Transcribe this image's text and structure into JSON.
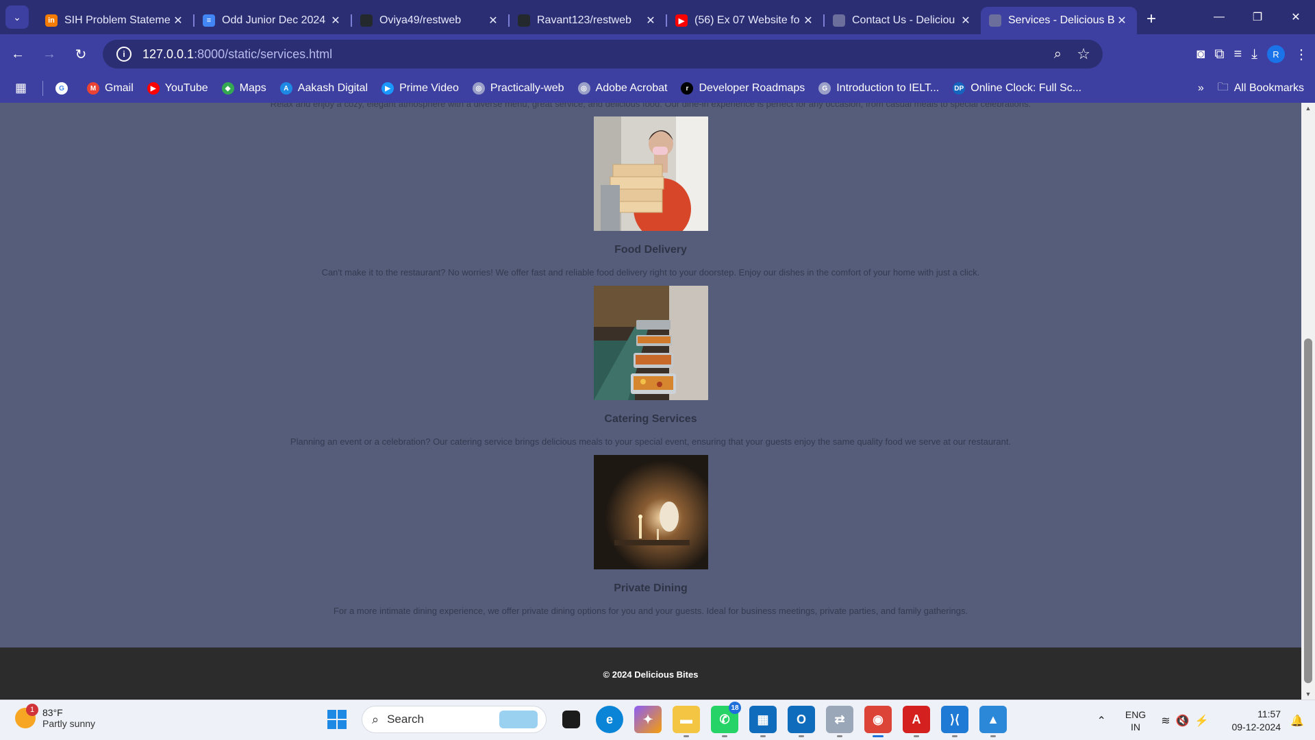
{
  "browser": {
    "tabs": [
      {
        "title": "SIH Problem Stateme",
        "favicon_color": "#f57c00",
        "favicon_text": "in"
      },
      {
        "title": "Odd Junior Dec 2024",
        "favicon_color": "#4285f4",
        "favicon_text": "≡"
      },
      {
        "title": "Oviya49/restweb",
        "favicon_color": "#24292e",
        "favicon_text": ""
      },
      {
        "title": "Ravant123/restweb",
        "favicon_color": "#24292e",
        "favicon_text": ""
      },
      {
        "title": "(56) Ex 07 Website fo",
        "favicon_color": "#ff0000",
        "favicon_text": "▶"
      },
      {
        "title": "Contact Us - Deliciou",
        "favicon_color": "#6c6f9c",
        "favicon_text": ""
      },
      {
        "title": "Services - Delicious B",
        "favicon_color": "#6c6f9c",
        "favicon_text": "",
        "active": true
      }
    ],
    "url": {
      "host": "127.0.0.1",
      "path": ":8000/static/services.html"
    },
    "bookmarks": [
      {
        "label": "",
        "color": "#ffffff",
        "text": "G"
      },
      {
        "label": "Gmail",
        "color": "#ea4335",
        "text": "M"
      },
      {
        "label": "YouTube",
        "color": "#ff0000",
        "text": "▶"
      },
      {
        "label": "Maps",
        "color": "#34a853",
        "text": "◆"
      },
      {
        "label": "Aakash Digital",
        "color": "#1e88e5",
        "text": "A"
      },
      {
        "label": "Prime Video",
        "color": "#1a98ff",
        "text": "▶"
      },
      {
        "label": "Practically-web",
        "color": "#9aa0c8",
        "text": "◎"
      },
      {
        "label": "Adobe Acrobat",
        "color": "#9aa0c8",
        "text": "◎"
      },
      {
        "label": "Developer Roadmaps",
        "color": "#000000",
        "text": "r"
      },
      {
        "label": "Introduction to IELT...",
        "color": "#9aa0c8",
        "text": "G"
      },
      {
        "label": "Online Clock: Full Sc...",
        "color": "#1565c0",
        "text": "DP"
      }
    ],
    "all_bookmarks_label": "All Bookmarks"
  },
  "page": {
    "intro_text": "Relax and enjoy a cozy, elegant atmosphere with a diverse menu, great service, and delicious food. Our dine-in experience is perfect for any occasion, from casual meals to special celebrations.",
    "services": [
      {
        "title": "Food Delivery",
        "description": "Can't make it to the restaurant? No worries! We offer fast and reliable food delivery right to your doorstep. Enjoy our dishes in the comfort of your home with just a click."
      },
      {
        "title": "Catering Services",
        "description": "Planning an event or a celebration? Our catering service brings delicious meals to your special event, ensuring that your guests enjoy the same quality food we serve at our restaurant."
      },
      {
        "title": "Private Dining",
        "description": "For a more intimate dining experience, we offer private dining options for you and your guests. Ideal for business meetings, private parties, and family gatherings."
      }
    ],
    "footer": "© 2024 Delicious Bites",
    "scroll_position_percent": 58
  },
  "taskbar": {
    "weather": {
      "temp": "83°F",
      "condition": "Partly sunny",
      "badge": "1"
    },
    "search_placeholder": "Search",
    "apps": [
      {
        "name": "file-explorer",
        "color": "#f4c542",
        "text": "▬"
      },
      {
        "name": "whatsapp",
        "color": "#25d366",
        "text": "✆",
        "count": "18"
      },
      {
        "name": "microsoft-store",
        "color": "#0f6cbd",
        "text": "▦"
      },
      {
        "name": "outlook",
        "color": "#0f6cbd",
        "text": "O"
      },
      {
        "name": "devices",
        "color": "#9aa7b8",
        "text": "⇄"
      },
      {
        "name": "chrome",
        "color": "#db4437",
        "text": "◉",
        "active": true
      },
      {
        "name": "acrobat",
        "color": "#d4201f",
        "text": "A"
      },
      {
        "name": "vscode",
        "color": "#1f7ad6",
        "text": "⟩⟨"
      },
      {
        "name": "photos",
        "color": "#2b88d8",
        "text": "▲"
      }
    ],
    "lang": {
      "line1": "ENG",
      "line2": "IN"
    },
    "clock": {
      "time": "11:57",
      "date": "09-12-2024"
    }
  }
}
